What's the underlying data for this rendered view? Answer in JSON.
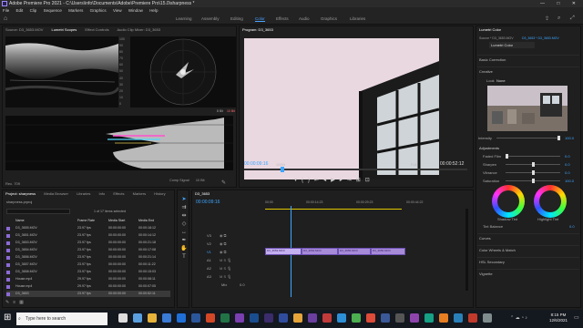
{
  "window": {
    "title": "Adobe Premiere Pro 2021 - C:\\Users\\info\\Documents\\Adobe\\Premiere Pro\\15.0\\sharpness *",
    "controls": [
      "—",
      "□",
      "✕"
    ]
  },
  "menu": [
    "File",
    "Edit",
    "Clip",
    "Sequence",
    "Markers",
    "Graphics",
    "View",
    "Window",
    "Help"
  ],
  "workspaces": {
    "items": [
      "Learning",
      "Assembly",
      "Editing",
      "Color",
      "Effects",
      "Audio",
      "Graphics",
      "Libraries"
    ],
    "active": "Color"
  },
  "source_panel": {
    "tabs": [
      "Source: D3_3653.MOV",
      "Lumetri Scopes",
      "Effect Controls",
      "Audio Clip Mixer: D3_3653"
    ],
    "active_tab": "Lumetri Scopes",
    "scale_labels": [
      "100",
      "90",
      "80",
      "70",
      "60",
      "50",
      "40",
      "30",
      "20",
      "10",
      "0"
    ],
    "footer": "Rec. 709",
    "scope_buttons": [
      "8 Bit",
      "10 Bit"
    ]
  },
  "program_monitor": {
    "title": "Program: D3_3653",
    "timecode": "00:00:09:16",
    "zoom": "100%",
    "quality": "Full",
    "duration": "00:00:52:12",
    "color_space": "Comp Signal",
    "page": "10 Bit"
  },
  "project_panel": {
    "tabs": [
      "Project: sharpness",
      "Media Browser",
      "Libraries",
      "Info",
      "Effects",
      "Markers",
      "History"
    ],
    "active_tab": "Project: sharpness",
    "file": "sharpness.prproj",
    "selection": "1 of 17 items selected",
    "columns": [
      "Name",
      "Frame Rate",
      "Media Start",
      "Media End"
    ],
    "rows": [
      {
        "name": "D3_3655.MOV",
        "fps": "23.97 fps",
        "start": "00:00:00:00",
        "end": "00:00:18:12"
      },
      {
        "name": "D3_3651.MOV",
        "fps": "23.97 fps",
        "start": "00:00:00:00",
        "end": "00:00:14:12"
      },
      {
        "name": "D3_3653.MOV",
        "fps": "23.97 fps",
        "start": "00:00:00:00",
        "end": "00:00:21:18"
      },
      {
        "name": "D3_3654.MOV",
        "fps": "23.97 fps",
        "start": "00:00:00:00",
        "end": "00:00:17:08"
      },
      {
        "name": "D3_3656.MOV",
        "fps": "23.97 fps",
        "start": "00:00:00:00",
        "end": "00:00:21:14"
      },
      {
        "name": "D3_3657.MOV",
        "fps": "23.97 fps",
        "start": "00:00:00:00",
        "end": "00:00:11:22"
      },
      {
        "name": "D3_3658.MOV",
        "fps": "23.97 fps",
        "start": "00:00:00:00",
        "end": "00:00:15:03"
      },
      {
        "name": "House.mp4",
        "fps": "29.97 fps",
        "start": "00:00:00:00",
        "end": "00:00:08:11"
      },
      {
        "name": "House.mp4",
        "fps": "29.97 fps",
        "start": "00:00:00:00",
        "end": "00:00:07:05"
      },
      {
        "name": "D3_3653",
        "fps": "23.97 fps",
        "start": "00:00:00:00",
        "end": "00:00:52:11"
      }
    ]
  },
  "timeline": {
    "tab": "D3_3653",
    "timecode": "00:00:09:16",
    "ruler": [
      "00:00",
      "00:00:14:23",
      "00:00:29:23",
      "00:00:44:22"
    ],
    "video_tracks": [
      "V3",
      "V2",
      "V1"
    ],
    "audio_tracks": [
      "A1",
      "A2",
      "A3"
    ],
    "master": "Mix",
    "master_value": "0.0",
    "clips": [
      "D3_3653.MOV",
      "D3_3654.MOV",
      "D3_3655.MOV",
      "D3_3656.MOV"
    ]
  },
  "lumetri": {
    "tabs": [
      "Lumetri Color"
    ],
    "clip_source": "Source * D3_3653.MOV",
    "clip_target": "D3_3653 * D3_3653.MOV",
    "effect": "Lumetri Color",
    "sections": [
      "Basic Correction",
      "Creative",
      "Curves",
      "Color Wheels & Match",
      "HSL Secondary",
      "Vignette"
    ],
    "look_label": "Look",
    "look_value": "None",
    "intensity_label": "Intensity",
    "intensity_value": "100.0",
    "adjustments_label": "Adjustments",
    "sliders": [
      {
        "label": "Faded Film",
        "value": "0.0",
        "pos": 0
      },
      {
        "label": "Sharpen",
        "value": "0.0",
        "pos": 0.5
      },
      {
        "label": "Vibrance",
        "value": "0.0",
        "pos": 0.5
      },
      {
        "label": "Saturation",
        "value": "100.0",
        "pos": 0.5
      }
    ],
    "wheels": [
      "Shadow Tint",
      "Highlight Tint"
    ],
    "tint_balance_label": "Tint Balance",
    "tint_balance_value": "0.0"
  },
  "taskbar": {
    "search_placeholder": "Type here to search",
    "time": "8:15 PM",
    "date": "12/6/2021"
  },
  "colors": {
    "accent": "#3ea6ff",
    "clip": "#a78bd9",
    "window": "#1d1d1d"
  }
}
